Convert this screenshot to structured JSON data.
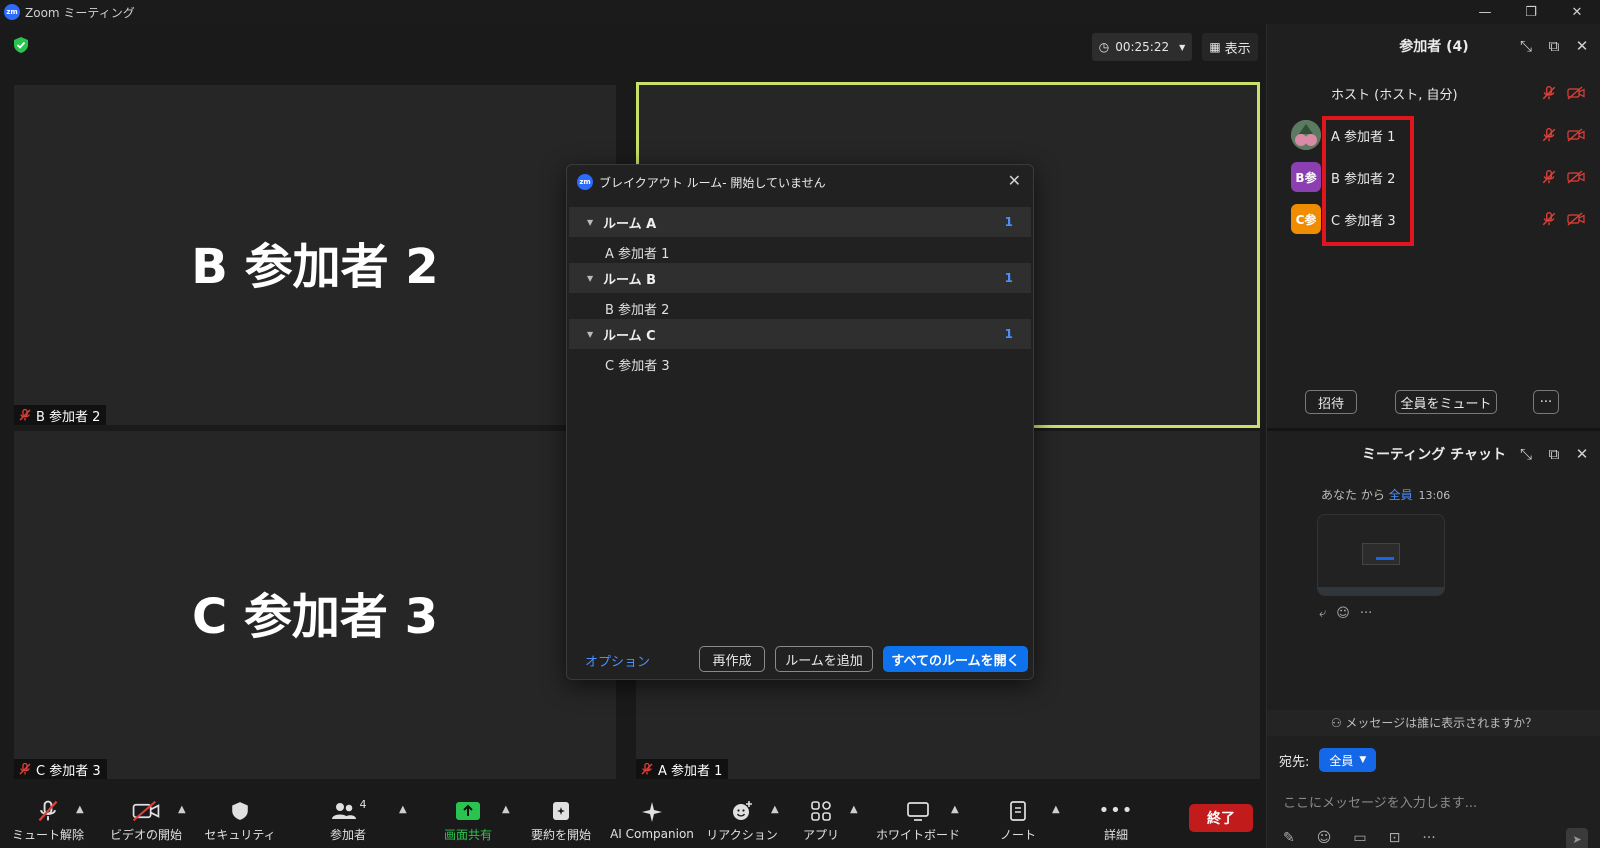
{
  "window": {
    "logo_text": "zm",
    "title": "Zoom ミーティング",
    "minimize": "—",
    "restore": "❐",
    "close": "✕"
  },
  "meeting": {
    "timer": "00:25:22",
    "view_label": "表示",
    "tiles": [
      {
        "big_name": "B 参加者 2",
        "tag": "B 参加者 2"
      },
      {
        "big_name": "C 参加者 3",
        "tag": "C 参加者 3"
      },
      {
        "tag": "A 参加者 1"
      }
    ]
  },
  "participants_panel": {
    "title": "参加者 (4)",
    "participants": [
      {
        "name": "ホスト (ホスト, 自分)",
        "avatar": "",
        "color": "#1f1f1f"
      },
      {
        "name": "A 参加者 1",
        "avatar": "",
        "color": "#6b8f6b"
      },
      {
        "name": "B 参加者 2",
        "avatar": "B参",
        "color": "#8b3fb0"
      },
      {
        "name": "C 参加者 3",
        "avatar": "C参",
        "color": "#f08c00"
      }
    ],
    "invite_label": "招待",
    "mute_all_label": "全員をミュート",
    "more_label": "···"
  },
  "chat_panel": {
    "title": "ミーティング チャット",
    "message": {
      "from": "あなた から",
      "to": "全員",
      "time": "13:06"
    },
    "who_sees": "メッセージは誰に表示されますか？",
    "to_label": "宛先:",
    "to_value": "全員",
    "placeholder": "ここにメッセージを入力します..."
  },
  "breakout_dialog": {
    "logo_text": "zm",
    "title": "ブレイクアウト ルーム- 開始していません",
    "rooms": [
      {
        "name": "ルーム A",
        "count": "1",
        "members": [
          "A 参加者 1"
        ]
      },
      {
        "name": "ルーム B",
        "count": "1",
        "members": [
          "B 参加者 2"
        ]
      },
      {
        "name": "ルーム C",
        "count": "1",
        "members": [
          "C 参加者 3"
        ]
      }
    ],
    "options_label": "オプション",
    "recreate_label": "再作成",
    "add_room_label": "ルームを追加",
    "open_all_label": "すべてのルームを開く"
  },
  "toolbar": {
    "unmute": "ミュート解除",
    "start_video": "ビデオの開始",
    "security": "セキュリティ",
    "participants": "参加者",
    "participants_count": "4",
    "share": "画面共有",
    "summary": "要約を開始",
    "ai": "AI Companion",
    "reactions": "リアクション",
    "apps": "アプリ",
    "whiteboard": "ホワイトボード",
    "notes": "ノート",
    "more": "詳細",
    "end": "終了"
  },
  "colors": {
    "accent": "#0e72ed",
    "active_speaker": "#c9e06a",
    "end": "#c11b1b",
    "share": "#2ac34f",
    "muted": "#e0403a"
  }
}
